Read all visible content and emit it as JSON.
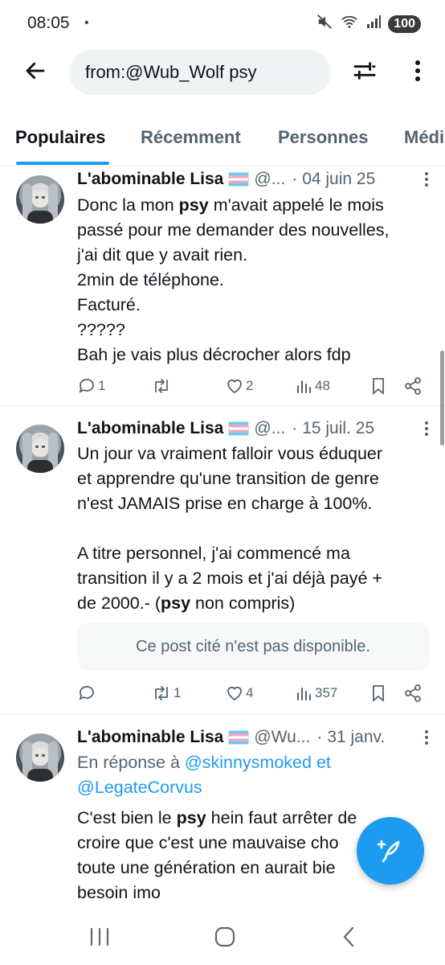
{
  "status_bar": {
    "time": "08:05",
    "dot": "•",
    "battery": "100"
  },
  "search": {
    "query": "from:@Wub_Wolf psy"
  },
  "tabs": [
    {
      "label": "Populaires",
      "active": true
    },
    {
      "label": "Récemment",
      "active": false
    },
    {
      "label": "Personnes",
      "active": false
    },
    {
      "label": "Médi",
      "active": false
    }
  ],
  "tweets": [
    {
      "name": "L'abominable Lisa",
      "handle": "@...",
      "date": "04 juin 25",
      "lines": [
        [
          "Donc la mon ",
          "psy",
          " m'avait appelé le mois"
        ],
        [
          "passé pour me demander des nouvelles,"
        ],
        [
          "j'ai dit que y avait rien."
        ],
        [
          "2min de téléphone."
        ],
        [
          "Facturé."
        ],
        [
          "?????"
        ],
        [
          "Bah je vais plus décrocher alors fdp"
        ]
      ],
      "replies": "1",
      "retweets": "",
      "likes": "2",
      "views": "48"
    },
    {
      "name": "L'abominable Lisa",
      "handle": "@...",
      "date": "15 juil. 25",
      "lines": [
        [
          "Un jour va vraiment falloir vous éduquer"
        ],
        [
          "et apprendre qu'une transition de genre"
        ],
        [
          "n'est JAMAIS prise en charge à 100%."
        ],
        [
          ""
        ],
        [
          "A titre personnel, j'ai commencé ma"
        ],
        [
          "transition il y a 2 mois et j'ai déjà payé +"
        ],
        [
          "de 2000.- (",
          "psy",
          " non compris)"
        ]
      ],
      "quote_unavailable": "Ce post cité n'est pas disponible.",
      "replies": "",
      "retweets": "1",
      "likes": "4",
      "views": "357"
    },
    {
      "name": "L'abominable Lisa",
      "handle": "@Wu...",
      "date": "31 janv.",
      "reply_prefix": "En réponse à",
      "reply_mention_1": "@skinnysmoked",
      "reply_and": "et",
      "reply_mention_2": "@LegateCorvus",
      "lines": [
        [
          "C'est bien le ",
          "psy",
          " hein faut arrêter de"
        ],
        [
          "croire que c'est une mauvaise cho"
        ],
        [
          "toute une génération en aurait bie"
        ],
        [
          "besoin imo"
        ]
      ]
    }
  ],
  "icons": {
    "back": "arrow-left-icon",
    "filter": "sliders-icon",
    "more": "more-vertical-icon",
    "reply": "comment-icon",
    "retweet": "retweet-icon",
    "like": "heart-icon",
    "views": "bar-chart-icon",
    "bookmark": "bookmark-icon",
    "share": "share-icon",
    "compose": "feather-plus-icon"
  },
  "colors": {
    "accent": "#1d9bf0",
    "muted": "#536471",
    "text": "#0f1419"
  }
}
